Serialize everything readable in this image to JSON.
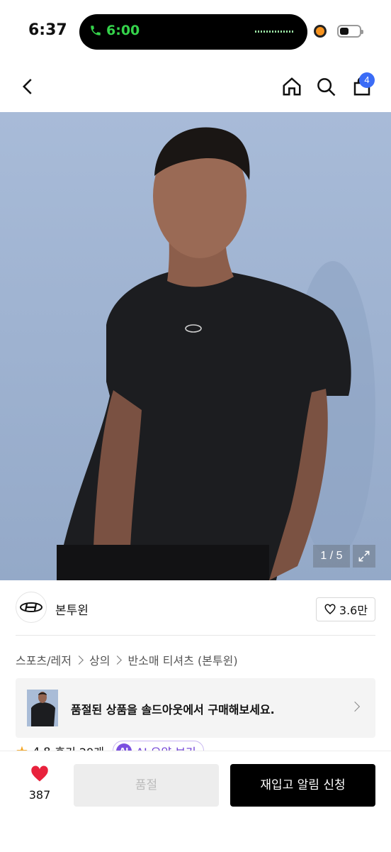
{
  "status_bar": {
    "time": "6:37",
    "call_time": "6:00"
  },
  "nav": {
    "cart_count": "4",
    "icons": [
      "back-icon",
      "home-icon",
      "search-icon",
      "cart-icon"
    ]
  },
  "gallery": {
    "counter": "1 / 5"
  },
  "brand": {
    "name": "본투윈",
    "likes": "3.6만"
  },
  "breadcrumb": [
    "스포츠/레저",
    "상의",
    "반소매 티셔츠 (본투윈)"
  ],
  "soldout_banner": {
    "text": "품절된 상품을 솔드아웃에서 구매해보세요."
  },
  "rating": {
    "score": "4.8",
    "reviews": "후기 29개",
    "ai_chip": "AI",
    "ai_label": "AI 요약 보기"
  },
  "bottom_bar": {
    "wish_count": "387",
    "soldout_label": "품절",
    "restock_label": "재입고 알림 신청"
  },
  "colors": {
    "call_green": "#35d34b",
    "badge_blue": "#3b6cf6",
    "heart_red": "#e8223c",
    "ai_purple": "#7b4fe0"
  }
}
